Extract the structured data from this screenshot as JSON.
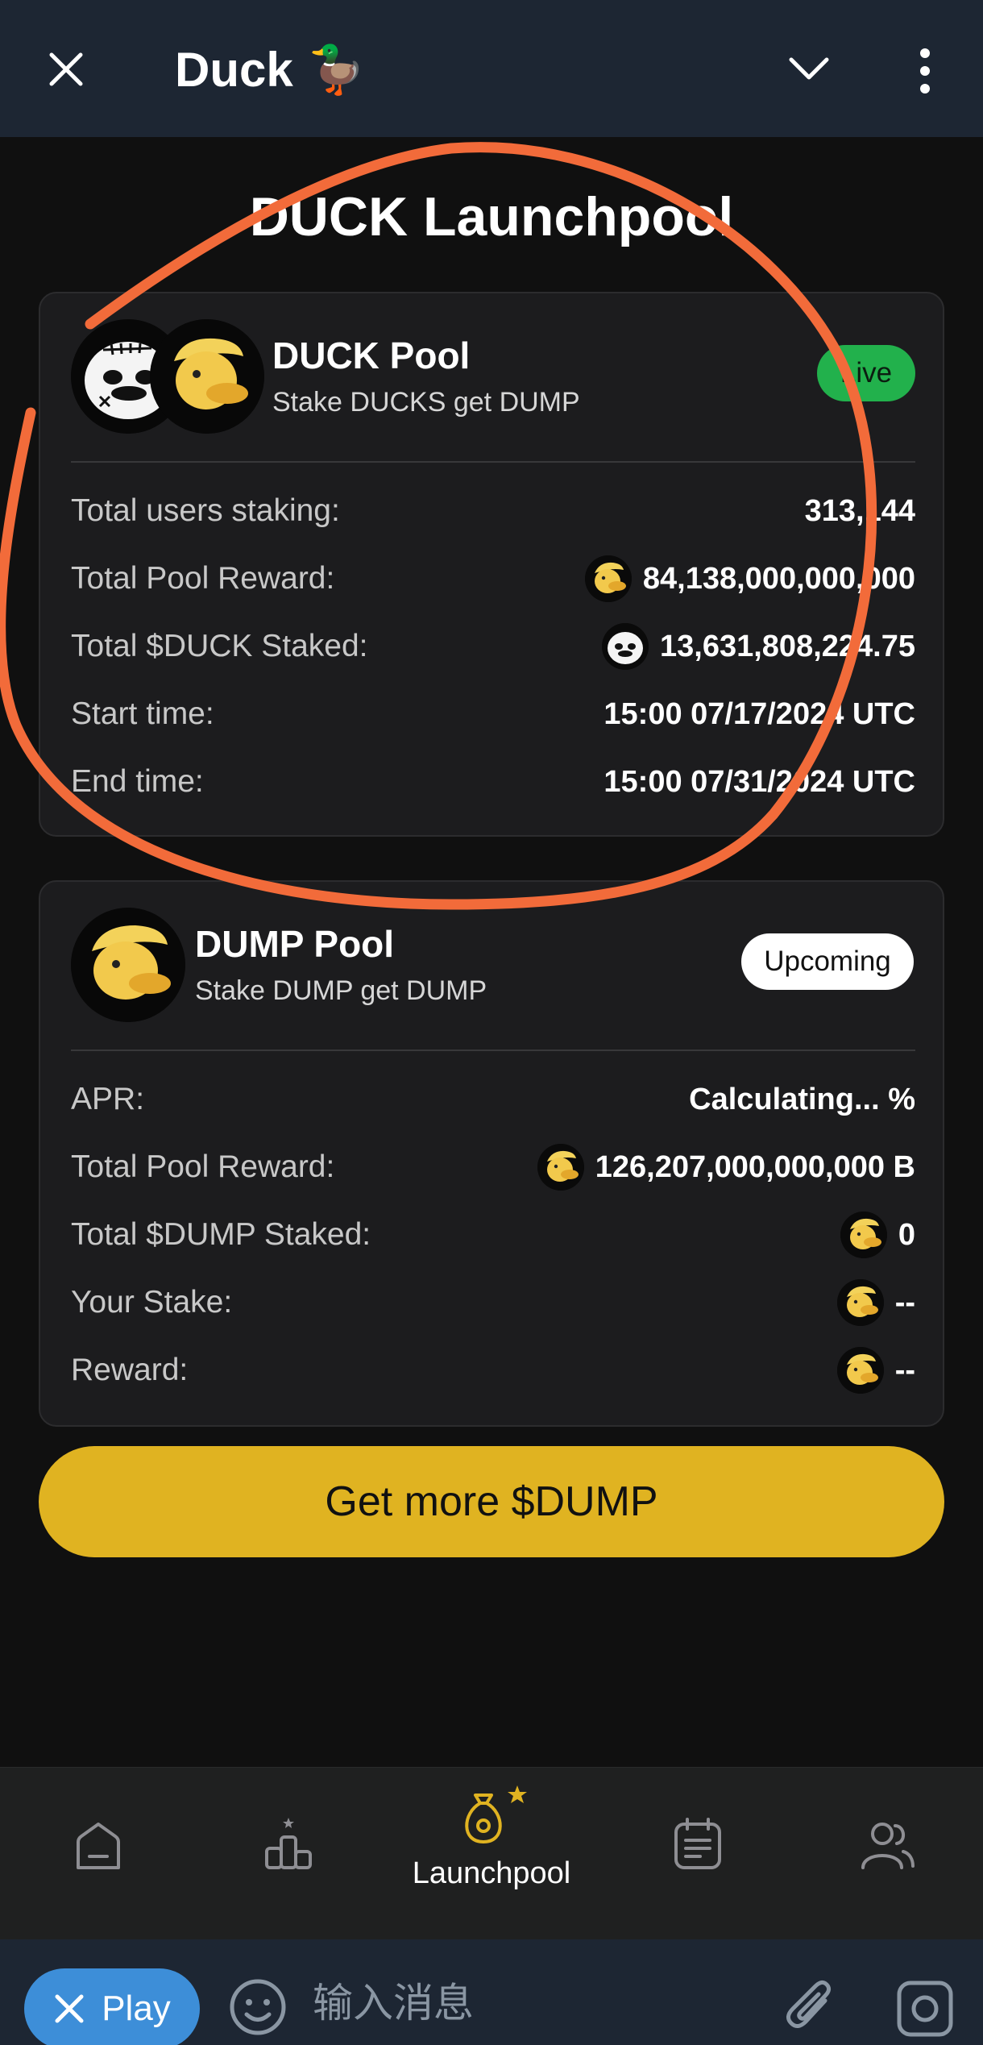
{
  "topbar": {
    "title": "Duck",
    "title_emoji": "🦆"
  },
  "page": {
    "title": "DUCK Launchpool"
  },
  "duck_pool": {
    "name": "DUCK Pool",
    "subtitle": "Stake DUCKS get DUMP",
    "status": "Live",
    "rows": [
      {
        "label": "Total users staking:",
        "value": "313,144",
        "icon": ""
      },
      {
        "label": "Total Pool Reward:",
        "value": "84,138,000,000,000",
        "icon": "dump-coin-icon"
      },
      {
        "label": "Total $DUCK Staked:",
        "value": "13,631,808,224.75",
        "icon": "duck-coin-icon"
      },
      {
        "label": "Start time:",
        "value": "15:00 07/17/2024 UTC",
        "icon": ""
      },
      {
        "label": "End time:",
        "value": "15:00 07/31/2024 UTC",
        "icon": ""
      }
    ]
  },
  "dump_pool": {
    "name": "DUMP Pool",
    "subtitle": "Stake DUMP get DUMP",
    "status": "Upcoming",
    "rows": [
      {
        "label": "APR:",
        "value": "Calculating... %",
        "icon": ""
      },
      {
        "label": "Total Pool Reward:",
        "value": "126,207,000,000,000 B",
        "icon": "dump-coin-icon"
      },
      {
        "label": "Total $DUMP Staked:",
        "value": "0",
        "icon": "dump-coin-icon"
      },
      {
        "label": "Your Stake:",
        "value": "--",
        "icon": "dump-coin-icon"
      },
      {
        "label": "Reward:",
        "value": "--",
        "icon": "dump-coin-icon"
      }
    ]
  },
  "cta": {
    "label": "Get more $DUMP"
  },
  "bottom_nav": {
    "items": [
      {
        "icon": "home-icon",
        "label": ""
      },
      {
        "icon": "leaderboard-icon",
        "label": ""
      },
      {
        "icon": "money-bag-icon",
        "label": "Launchpool",
        "active": true
      },
      {
        "icon": "tasks-icon",
        "label": ""
      },
      {
        "icon": "friends-icon",
        "label": ""
      }
    ]
  },
  "input_bar": {
    "play_label": "Play",
    "placeholder": "输入消息"
  },
  "colors": {
    "accent_yellow": "#e0b321",
    "live_green": "#22b14c",
    "annotation_orange": "#f26b3a",
    "telegram_bar": "#1d2633"
  }
}
